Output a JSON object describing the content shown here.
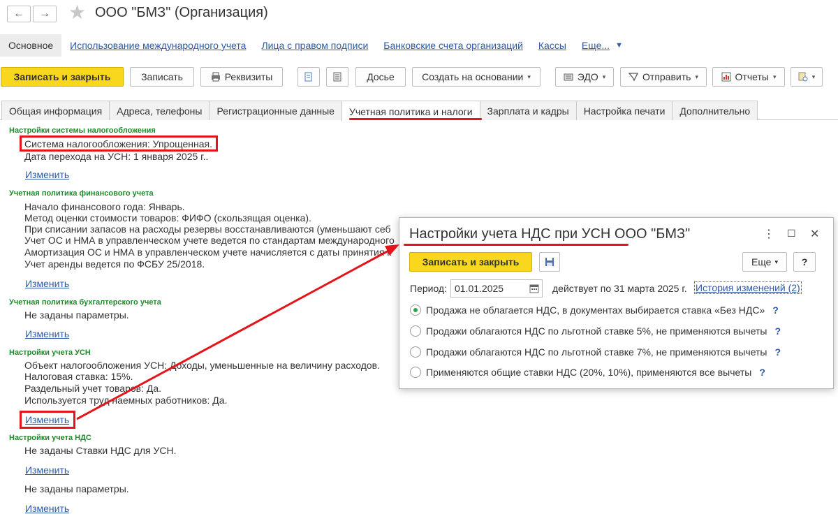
{
  "window": {
    "back_glyph": "←",
    "forward_glyph": "→",
    "star_glyph": "★",
    "title": "ООО \"БМЗ\" (Организация)"
  },
  "nav": {
    "selected": "Основное",
    "links": [
      "Использование международного учета",
      "Лица с правом подписи",
      "Банковские счета организаций",
      "Кассы",
      "Еще..."
    ],
    "more_arrow": "▼"
  },
  "toolbar": {
    "save_close": "Записать и закрыть",
    "save": "Записать",
    "requisites": "Реквизиты",
    "dossier": "Досье",
    "create_based": "Создать на основании",
    "edo": "ЭДО",
    "send": "Отправить",
    "reports": "Отчеты",
    "dropdown_arrow": "▾"
  },
  "tabs": [
    "Общая информация",
    "Адреса, телефоны",
    "Регистрационные данные",
    "Учетная политика и налоги",
    "Зарплата и кадры",
    "Настройка печати",
    "Дополнительно"
  ],
  "sections": {
    "tax_system": {
      "header": "Настройки системы налогообложения",
      "lines": [
        "Система налогообложения: Упрощенная.",
        "Дата перехода на УСН: 1 января 2025 г.."
      ],
      "change": "Изменить"
    },
    "fin_policy": {
      "header": "Учетная политика финансового учета",
      "lines": [
        "Начало финансового года: Январь.",
        "Метод оценки стоимости товаров: ФИФО (скользящая оценка).",
        "При списании запасов на расходы резервы восстанавливаются (уменьшают себ",
        "Учет ОС и НМА в управленческом учете ведется по стандартам международного",
        "Амортизация ОС и НМА в управленческом учете начисляется с даты принятия к",
        "Учет аренды ведется по ФСБУ 25/2018."
      ],
      "change": "Изменить"
    },
    "acc_policy": {
      "header": "Учетная политика бухгалтерского учета",
      "lines": [
        "Не заданы параметры."
      ],
      "change": "Изменить"
    },
    "usn": {
      "header": "Настройки учета УСН",
      "lines": [
        "Объект налогообложения УСН: Доходы, уменьшенные на величину расходов.",
        "Налоговая ставка: 15%.",
        "Раздельный учет товаров: Да.",
        "Используется труд наемных работников: Да."
      ],
      "change": "Изменить"
    },
    "vat": {
      "header": "Настройки учета НДС",
      "line1": "Не заданы Ставки НДС для УСН.",
      "change1": "Изменить",
      "line2": "Не заданы параметры.",
      "change2": "Изменить"
    }
  },
  "dialog": {
    "title": "Настройки учета НДС при УСН ООО \"БМЗ\"",
    "menu_glyph": "⋮",
    "maximize_glyph": "☐",
    "close_glyph": "✕",
    "save_close": "Записать и закрыть",
    "more": "Еще",
    "help": "?",
    "period_label": "Период:",
    "period_value": "01.01.2025",
    "valid_text": "действует по 31 марта 2025 г.",
    "history_link": "История изменений (2)",
    "options": [
      {
        "label": "Продажа не облагается НДС, в документах выбирается ставка «Без НДС»",
        "selected": true
      },
      {
        "label": "Продажи облагаются НДС по льготной ставке 5%, не применяются вычеты",
        "selected": false
      },
      {
        "label": "Продажи облагаются НДС по льготной ставке 7%, не применяются вычеты",
        "selected": false
      },
      {
        "label": "Применяются общие ставки НДС (20%, 10%), применяются все вычеты",
        "selected": false
      }
    ],
    "option_help": "?"
  },
  "colors": {
    "accent_yellow": "#f9d71c",
    "link_blue": "#3058a8",
    "section_green": "#1f8a2a",
    "annotation_red": "#e3141a"
  }
}
